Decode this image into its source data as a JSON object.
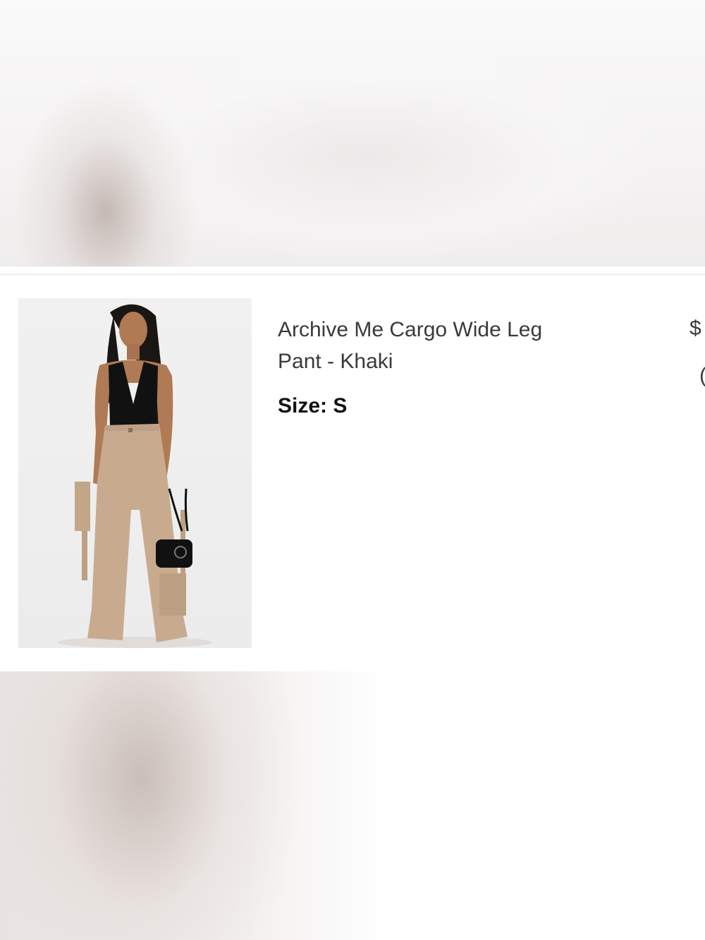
{
  "cart_item": {
    "title": "Archive Me Cargo Wide Leg Pant - Khaki",
    "size_label": "Size:",
    "size_value": "S",
    "price_partial": "$",
    "qty_partial": "("
  },
  "colors": {
    "text_primary": "#3a3a3a",
    "text_strong": "#111111",
    "divider": "#ececec",
    "pants_khaki": "#c8ab8f",
    "top_black": "#111111"
  },
  "icons": {
    "product_photo": "model-wearing-khaki-cargo-pants"
  }
}
